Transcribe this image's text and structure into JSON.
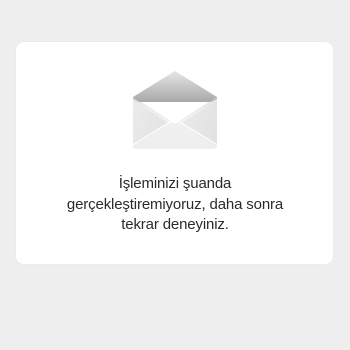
{
  "error_card": {
    "icon": "envelope-icon",
    "message_lines": [
      "İşleminizi şuanda",
      "gerçekleştiremiyoruz, daha sonra",
      "tekrar deneyiniz."
    ]
  },
  "colors": {
    "background": "#eeeeee",
    "card": "#ffffff",
    "text": "#2b2b2b",
    "envelope_body": "#f1f1f1",
    "envelope_flap_light": "#e0e0e0",
    "envelope_flap_dark": "#a9a9a9"
  }
}
